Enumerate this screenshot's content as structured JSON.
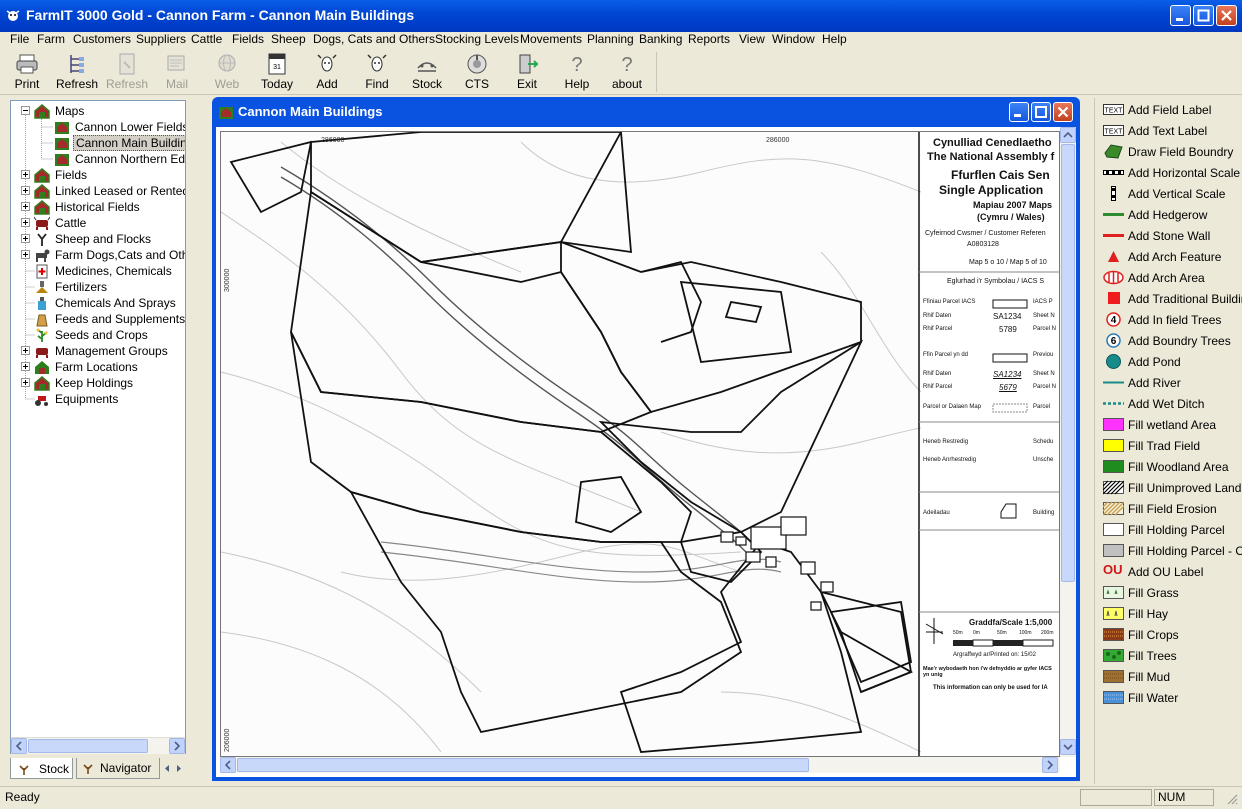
{
  "window": {
    "title": "FarmIT 3000 Gold - Cannon Farm - Cannon Main Buildings"
  },
  "menu": [
    "File",
    "Farm",
    "Customers",
    "Suppliers",
    "Cattle",
    "Fields",
    "Sheep",
    "Dogs, Cats and Others",
    "Stocking Levels",
    "Movements",
    "Planning",
    "Banking",
    "Reports",
    "View",
    "Window",
    "Help"
  ],
  "toolbar": [
    {
      "label": "Print",
      "icon": "printer-icon",
      "enabled": true
    },
    {
      "label": "Refresh",
      "icon": "tree-refresh-icon",
      "enabled": true
    },
    {
      "label": "Refresh",
      "icon": "page-refresh-icon",
      "enabled": false
    },
    {
      "label": "Mail",
      "icon": "mail-icon",
      "enabled": false
    },
    {
      "label": "Web",
      "icon": "globe-icon",
      "enabled": false
    },
    {
      "label": "Today",
      "icon": "calendar-icon",
      "enabled": true
    },
    {
      "label": "Add",
      "icon": "cow-add-icon",
      "enabled": true
    },
    {
      "label": "Find",
      "icon": "cow-find-icon",
      "enabled": true
    },
    {
      "label": "Stock",
      "icon": "stock-icon",
      "enabled": true
    },
    {
      "label": "CTS",
      "icon": "cts-icon",
      "enabled": true
    },
    {
      "label": "Exit",
      "icon": "exit-door-icon",
      "enabled": true
    },
    {
      "label": "Help",
      "icon": "help-icon",
      "enabled": true
    },
    {
      "label": "about",
      "icon": "about-icon",
      "enabled": true
    }
  ],
  "tree": {
    "items": [
      {
        "label": "Maps",
        "level": 0,
        "expander": "minus",
        "icon": "barn-icon"
      },
      {
        "label": "Cannon Lower Fields",
        "level": 1,
        "expander": "",
        "icon": "map-barn-icon"
      },
      {
        "label": "Cannon Main Buildings",
        "level": 1,
        "expander": "",
        "icon": "map-barn-icon",
        "selected": true
      },
      {
        "label": "Cannon Northern Edge",
        "level": 1,
        "expander": "",
        "icon": "map-barn-icon"
      },
      {
        "label": "Fields",
        "level": 0,
        "expander": "plus",
        "icon": "barn-icon"
      },
      {
        "label": "Linked Leased or Rented Fi",
        "level": 0,
        "expander": "plus",
        "icon": "barn-icon"
      },
      {
        "label": "Historical Fields",
        "level": 0,
        "expander": "plus",
        "icon": "barn-icon"
      },
      {
        "label": "Cattle",
        "level": 0,
        "expander": "plus",
        "icon": "cow-icon"
      },
      {
        "label": "Sheep and Flocks",
        "level": 0,
        "expander": "plus",
        "icon": "sheep-icon"
      },
      {
        "label": "Farm Dogs,Cats and Other",
        "level": 0,
        "expander": "plus",
        "icon": "dog-icon"
      },
      {
        "label": "Medicines, Chemicals",
        "level": 0,
        "expander": "",
        "icon": "medicine-icon"
      },
      {
        "label": "Fertilizers",
        "level": 0,
        "expander": "",
        "icon": "fertilizer-icon"
      },
      {
        "label": "Chemicals And Sprays",
        "level": 0,
        "expander": "",
        "icon": "spray-icon"
      },
      {
        "label": "Feeds and Supplements",
        "level": 0,
        "expander": "",
        "icon": "feed-icon"
      },
      {
        "label": "Seeds and Crops",
        "level": 0,
        "expander": "",
        "icon": "crop-icon"
      },
      {
        "label": "Management Groups",
        "level": 0,
        "expander": "plus",
        "icon": "group-icon"
      },
      {
        "label": "Farm Locations",
        "level": 0,
        "expander": "plus",
        "icon": "location-icon"
      },
      {
        "label": "Keep Holdings",
        "level": 0,
        "expander": "plus",
        "icon": "holding-icon"
      },
      {
        "label": "Equipments",
        "level": 0,
        "expander": "",
        "icon": "tractor-icon"
      }
    ]
  },
  "tabs": [
    {
      "label": "Stock",
      "active": true
    },
    {
      "label": "Navigator",
      "active": false
    }
  ],
  "child_window": {
    "title": "Cannon Main Buildings"
  },
  "map": {
    "grid_labels": [
      "286000",
      "286000",
      "300000",
      "206000"
    ],
    "header_lines": [
      "Cynulliad Cenedlaetho",
      "The National Assembly f",
      "Ffurflen Cais Sen",
      "Single Application",
      "Mapiau 2007 Maps",
      "(Cymru / Wales)"
    ],
    "customer_ref_label": "Cyfeirnod Cwsmer / Customer Referen",
    "customer_ref": "A0803128",
    "map_index": "Map 5 o 10 / Map 5 of 10",
    "legend_title": "Eglurhad i'r Symbolau / IACS S",
    "legend_rows": [
      {
        "left": "Ffiniau Parcel IACS",
        "right": "IACS P"
      },
      {
        "left": "Rhif Daten",
        "code": "SA1234",
        "right": "Sheet N"
      },
      {
        "left": "Rhif Parcel",
        "code": "5789",
        "right": "Parcel N"
      },
      {
        "left": "Ffin Parcel yn dd",
        "right": "Previou"
      },
      {
        "left": "Rhif Daten",
        "code": "SA1234",
        "right": "Sheet N"
      },
      {
        "left": "Rhif Parcel",
        "code": "5679",
        "right": "Parcel N"
      },
      {
        "left": "Parcel or Dalaen Map",
        "right": "Parcel"
      },
      {
        "left": "Heneb Restredig",
        "right": "Schedu"
      },
      {
        "left": "Heneb Anrhestredig",
        "right": "Unsche"
      },
      {
        "left": "Adeiladau",
        "right": "Building"
      }
    ],
    "scale_label": "Graddfa/Scale 1:5,000",
    "scale_ticks": [
      "50m",
      "0m",
      "50m",
      "100m",
      "200m"
    ],
    "printed_on": "Argraffwyd ar/Printed on: 15/02",
    "disclaimer_1": "Mae'r wybodaeth hon i'w defnyddio ar gyfer IACS yn unig",
    "disclaimer_2": "This information can only be used for IA"
  },
  "right_panel": {
    "items": [
      {
        "label": "Add Field Label",
        "swatch": "text-label"
      },
      {
        "label": "Add Text Label",
        "swatch": "text-label"
      },
      {
        "label": "Draw Field Boundry",
        "swatch": "field-boundary"
      },
      {
        "label": "Add Horizontal Scale",
        "swatch": "h-scale"
      },
      {
        "label": "Add Vertical Scale",
        "swatch": "v-scale"
      },
      {
        "label": "Add Hedgerow",
        "swatch": "line",
        "color": "#2e8b2e"
      },
      {
        "label": "Add Stone Wall",
        "swatch": "line",
        "color": "#e02020"
      },
      {
        "label": "Add Arch Feature",
        "swatch": "triangle",
        "color": "#e02020"
      },
      {
        "label": "Add Arch Area",
        "swatch": "arch-area",
        "color": "#e02020"
      },
      {
        "label": "Add Traditional Buildin",
        "swatch": "square",
        "color": "#ee1c1c"
      },
      {
        "label": "Add In field Trees",
        "swatch": "numcircle",
        "num": "4",
        "color": "#e02020"
      },
      {
        "label": "Add Boundry Trees",
        "swatch": "numcircle",
        "num": "6",
        "color": "#2a7ab5"
      },
      {
        "label": "Add Pond",
        "swatch": "circle",
        "color": "#178b8b"
      },
      {
        "label": "Add River",
        "swatch": "line",
        "color": "#178b8b"
      },
      {
        "label": "Add Wet Ditch",
        "swatch": "dashed",
        "color": "#178b8b"
      },
      {
        "label": "Fill wetland Area",
        "swatch": "fill",
        "color": "#ff33ff"
      },
      {
        "label": "Fill Trad Field",
        "swatch": "fill",
        "color": "#ffff00"
      },
      {
        "label": "Fill Woodland Area",
        "swatch": "fill",
        "color": "#1e8c1e"
      },
      {
        "label": "Fill Unimproved Land",
        "swatch": "hatch",
        "color": "#000000"
      },
      {
        "label": "Fill Field Erosion",
        "swatch": "hatch",
        "color": "#c8a050"
      },
      {
        "label": "Fill Holding Parcel",
        "swatch": "fill",
        "color": "#ffffff"
      },
      {
        "label": "Fill Holding Parcel - Otl",
        "swatch": "fill",
        "color": "#c0c0c0"
      },
      {
        "label": "Add OU Label",
        "swatch": "ou"
      },
      {
        "label": "Fill Grass",
        "swatch": "pattern",
        "color": "#e8f5e0"
      },
      {
        "label": "Fill Hay",
        "swatch": "pattern",
        "color": "#ffff66"
      },
      {
        "label": "Fill Crops",
        "swatch": "pattern",
        "color": "#8b3a1a"
      },
      {
        "label": "Fill Trees",
        "swatch": "pattern",
        "color": "#33aa33"
      },
      {
        "label": "Fill Mud",
        "swatch": "pattern",
        "color": "#a07030"
      },
      {
        "label": "Fill Water",
        "swatch": "pattern",
        "color": "#4a90d9"
      }
    ],
    "ou_text": "OU",
    "text_badge": "TEXT"
  },
  "status": {
    "text": "Ready",
    "num": "NUM"
  }
}
